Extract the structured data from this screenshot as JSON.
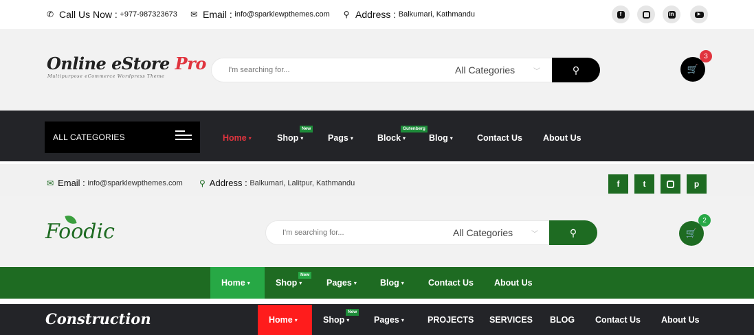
{
  "estore": {
    "topbar": {
      "call_label": "Call Us Now :",
      "call_value": "+977-987323673",
      "email_label": "Email :",
      "email_value": "info@sparklewpthemes.com",
      "address_label": "Address :",
      "address_value": "Balkumari, Kathmandu",
      "social_icons": [
        "facebook-icon",
        "instagram-icon",
        "linkedin-icon",
        "youtube-icon"
      ]
    },
    "logo": {
      "main": "Online eStore ",
      "accent": "Pro",
      "tagline": "Multipurpose eCommerce Wordpress Theme"
    },
    "search": {
      "placeholder": "I'm searching for...",
      "category": "All Categories"
    },
    "cart_count": "3",
    "all_categories": "ALL CATEGORIES",
    "nav": {
      "home": "Home",
      "shop": "Shop",
      "shop_badge": "New",
      "pags": "Pags",
      "block": "Block",
      "block_badge": "Gutenberg",
      "blog": "Blog",
      "contact": "Contact Us",
      "about": "About Us"
    },
    "colors": {
      "accent": "#e0343e",
      "dark": "#232428",
      "badge": "#1e8c3a"
    }
  },
  "foodic": {
    "topbar": {
      "email_label": "Email :",
      "email_value": "info@sparklewpthemes.com",
      "address_label": "Address :",
      "address_value": "Balkumari, Lalitpur, Kathmandu",
      "social_icons": [
        "facebook-icon",
        "twitter-icon",
        "instagram-icon",
        "pinterest-icon"
      ]
    },
    "logo": "Foodic",
    "search": {
      "placeholder": "I'm searching for...",
      "category": "All Categories"
    },
    "cart_count": "2",
    "nav": {
      "home": "Home",
      "shop": "Shop",
      "shop_badge": "New",
      "pages": "Pages",
      "blog": "Blog",
      "contact": "Contact Us",
      "about": "About Us"
    },
    "colors": {
      "primary": "#1e6b22",
      "active": "#27a845"
    }
  },
  "construction": {
    "logo": "Construction",
    "nav": {
      "home": "Home",
      "shop": "Shop",
      "shop_badge": "New",
      "pages": "Pages",
      "projects": "PROJECTS",
      "services": "SERVICES",
      "blog": "BLOG",
      "contact": "Contact Us",
      "about": "About Us"
    },
    "colors": {
      "active": "#ff1c1c",
      "dark": "#232428"
    }
  }
}
